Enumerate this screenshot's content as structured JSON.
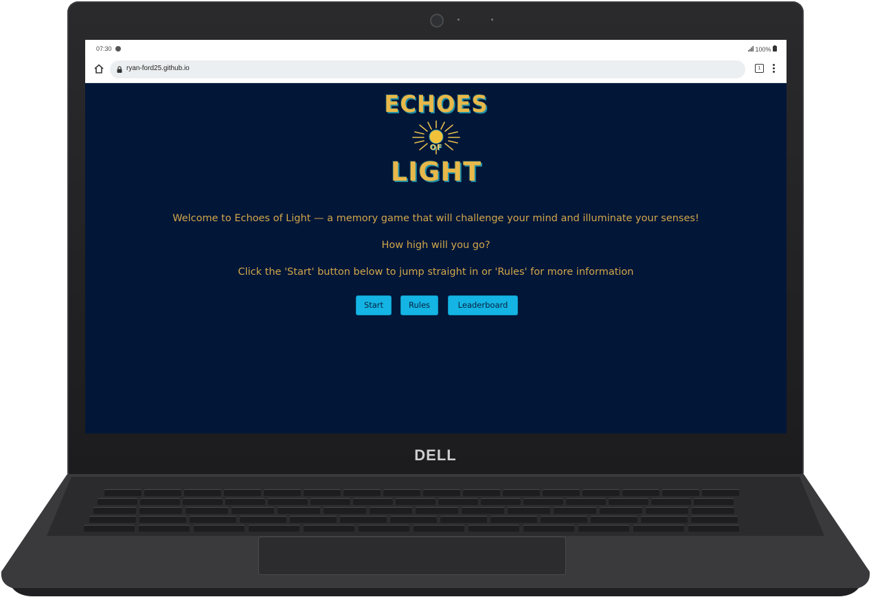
{
  "device": {
    "brand_logo": "DELL"
  },
  "status_bar": {
    "time": "07:30",
    "battery": "100%",
    "icons": [
      "notification-icon",
      "signal-icon",
      "battery-icon"
    ]
  },
  "browser": {
    "url": "ryan-ford25.github.io",
    "tab_count": "1",
    "icons": [
      "home-icon",
      "lock-icon",
      "tabs-icon",
      "menu-icon"
    ]
  },
  "page": {
    "logo": {
      "line1": "ECHOES",
      "line2": "OF",
      "line3": "LIGHT"
    },
    "welcome_text": "Welcome to Echoes of Light — a memory game that will challenge your mind and illuminate your senses!",
    "how_high_text": "How high will you go?",
    "instructions_text": "Click the 'Start' button below to jump straight in or 'Rules' for more information",
    "buttons": {
      "start": "Start",
      "rules": "Rules",
      "leaderboard": "Leaderboard"
    }
  },
  "colors": {
    "page_background": "#021638",
    "text_gold": "#d2a74a",
    "button_cyan": "#14b4e4",
    "logo_gold": "#e8b84a",
    "logo_teal": "#1f8fa6"
  }
}
